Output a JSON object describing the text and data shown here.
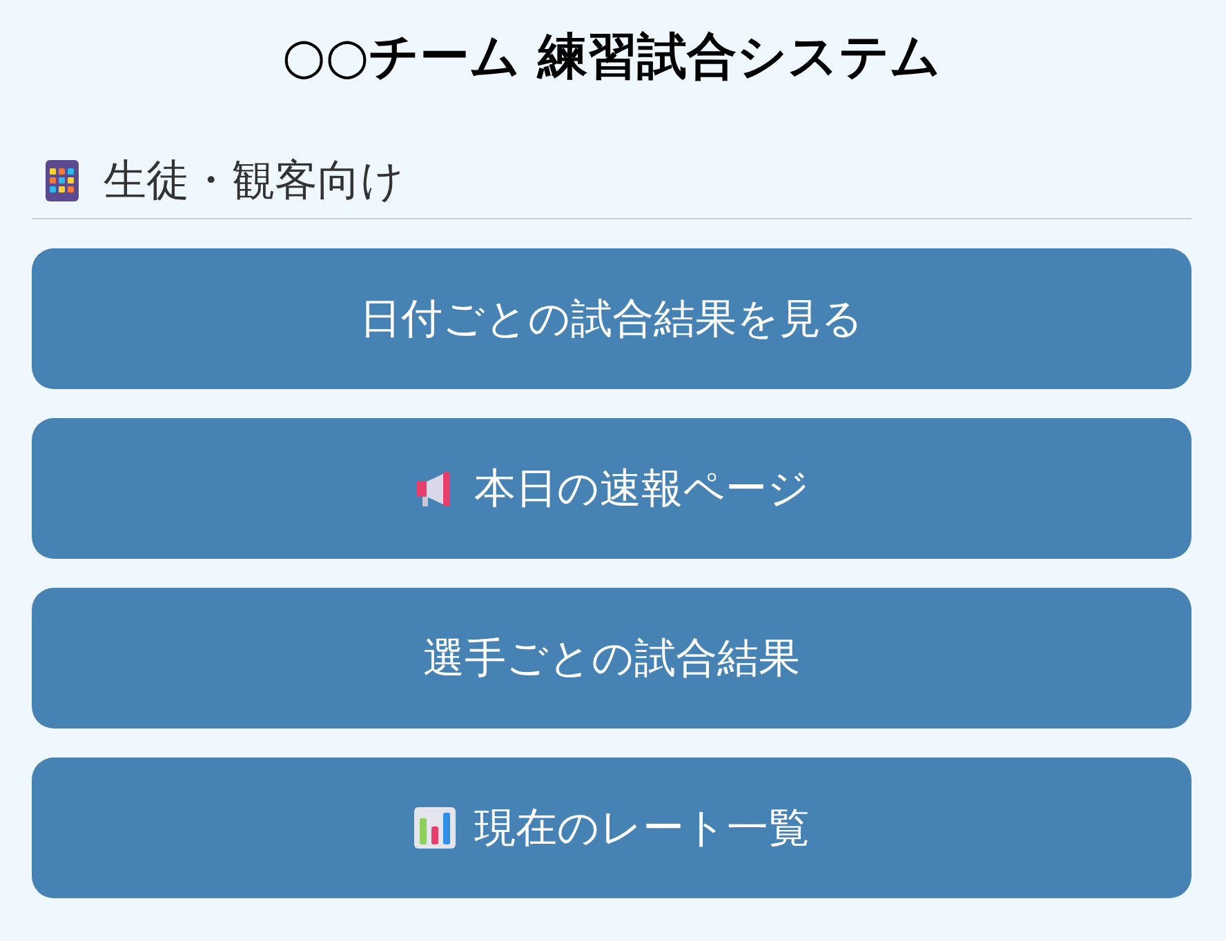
{
  "title": "○○チーム 練習試合システム",
  "section": {
    "heading": "生徒・観客向け",
    "kind": "grid"
  },
  "buttons": [
    {
      "label": "日付ごとの試合結果を見る",
      "kind": "plain"
    },
    {
      "label": "本日の速報ページ",
      "kind": "megaphone"
    },
    {
      "label": "選手ごとの試合結果",
      "kind": "plain"
    },
    {
      "label": "現在のレート一覧",
      "kind": "chart"
    }
  ]
}
